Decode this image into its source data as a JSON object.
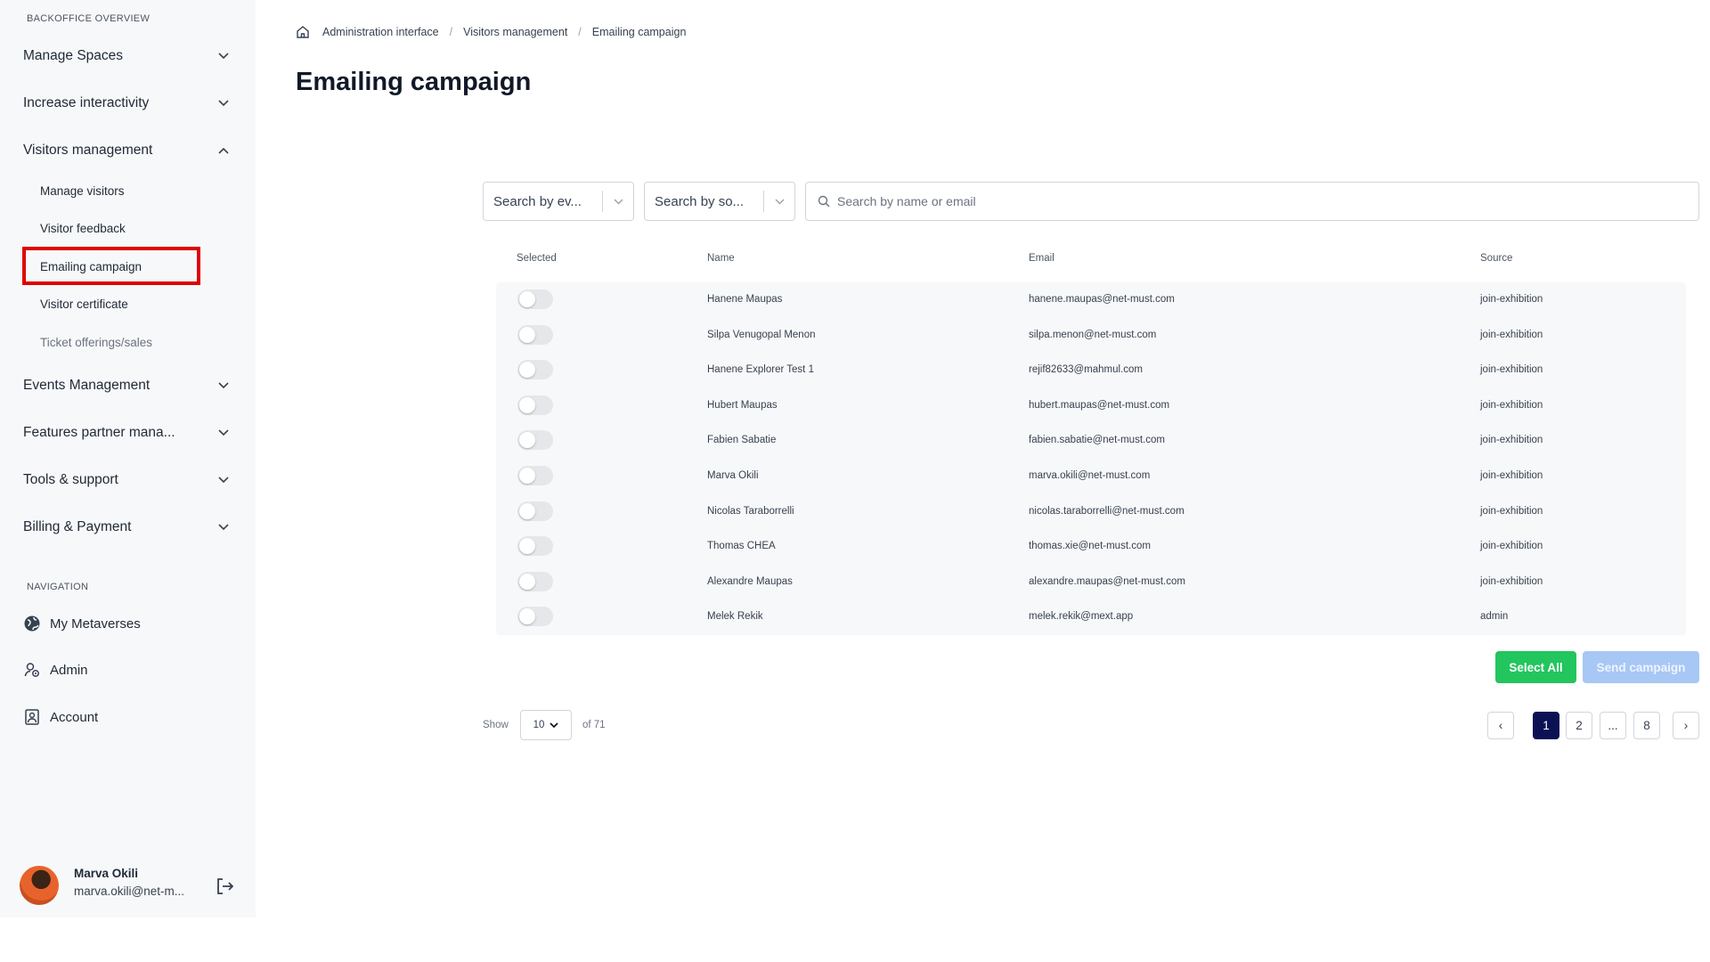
{
  "sidebar": {
    "section_overview": "BACKOFFICE OVERVIEW",
    "menu": [
      {
        "label": "Manage Spaces",
        "expanded": false
      },
      {
        "label": "Increase interactivity",
        "expanded": false
      },
      {
        "label": "Visitors management",
        "expanded": true
      },
      {
        "label": "Events Management",
        "expanded": false
      },
      {
        "label": "Features partner mana...",
        "expanded": false
      },
      {
        "label": "Tools & support",
        "expanded": false
      },
      {
        "label": "Billing & Payment",
        "expanded": false
      }
    ],
    "submenu": [
      "Manage visitors",
      "Visitor feedback",
      "Emailing campaign",
      "Visitor certificate",
      "Ticket offerings/sales"
    ],
    "section_navigation": "NAVIGATION",
    "nav": [
      {
        "label": "My Metaverses",
        "icon": "globe-icon"
      },
      {
        "label": "Admin",
        "icon": "admin-icon"
      },
      {
        "label": "Account",
        "icon": "account-icon"
      }
    ],
    "user": {
      "name": "Marva Okili",
      "email": "marva.okili@net-m..."
    }
  },
  "breadcrumb": [
    "Administration interface",
    "Visitors management",
    "Emailing campaign"
  ],
  "page_title": "Emailing campaign",
  "filters": {
    "event_placeholder": "Search by ev...",
    "source_placeholder": "Search by so...",
    "search_placeholder": "Search by name or email"
  },
  "table": {
    "headers": [
      "Selected",
      "Name",
      "Email",
      "Source"
    ],
    "rows": [
      {
        "selected": false,
        "name": "Hanene Maupas",
        "email": "hanene.maupas@net-must.com",
        "source": "join-exhibition"
      },
      {
        "selected": false,
        "name": "Silpa Venugopal Menon",
        "email": "silpa.menon@net-must.com",
        "source": "join-exhibition"
      },
      {
        "selected": false,
        "name": "Hanene Explorer Test 1",
        "email": "rejif82633@mahmul.com",
        "source": "join-exhibition"
      },
      {
        "selected": false,
        "name": "Hubert Maupas",
        "email": "hubert.maupas@net-must.com",
        "source": "join-exhibition"
      },
      {
        "selected": false,
        "name": "Fabien Sabatie",
        "email": "fabien.sabatie@net-must.com",
        "source": "join-exhibition"
      },
      {
        "selected": false,
        "name": "Marva Okili",
        "email": "marva.okili@net-must.com",
        "source": "join-exhibition"
      },
      {
        "selected": false,
        "name": "Nicolas Taraborrelli",
        "email": "nicolas.taraborrelli@net-must.com",
        "source": "join-exhibition"
      },
      {
        "selected": false,
        "name": "Thomas CHEA",
        "email": "thomas.xie@net-must.com",
        "source": "join-exhibition"
      },
      {
        "selected": false,
        "name": "Alexandre Maupas",
        "email": "alexandre.maupas@net-must.com",
        "source": "join-exhibition"
      },
      {
        "selected": false,
        "name": "Melek Rekik",
        "email": "melek.rekik@mext.app",
        "source": "admin"
      }
    ]
  },
  "actions": {
    "select_all": "Select All",
    "send_campaign": "Send campaign"
  },
  "pagination": {
    "show_label": "Show",
    "page_size": "10",
    "total_label": "of 71",
    "pages": [
      "1",
      "2",
      "...",
      "8"
    ],
    "current": "1",
    "prev": "‹",
    "next": "›"
  },
  "colors": {
    "accent_green": "#22c55e",
    "send_disabled": "#a7c7f5",
    "active_page": "#0b1254",
    "highlight": "#e00000"
  }
}
